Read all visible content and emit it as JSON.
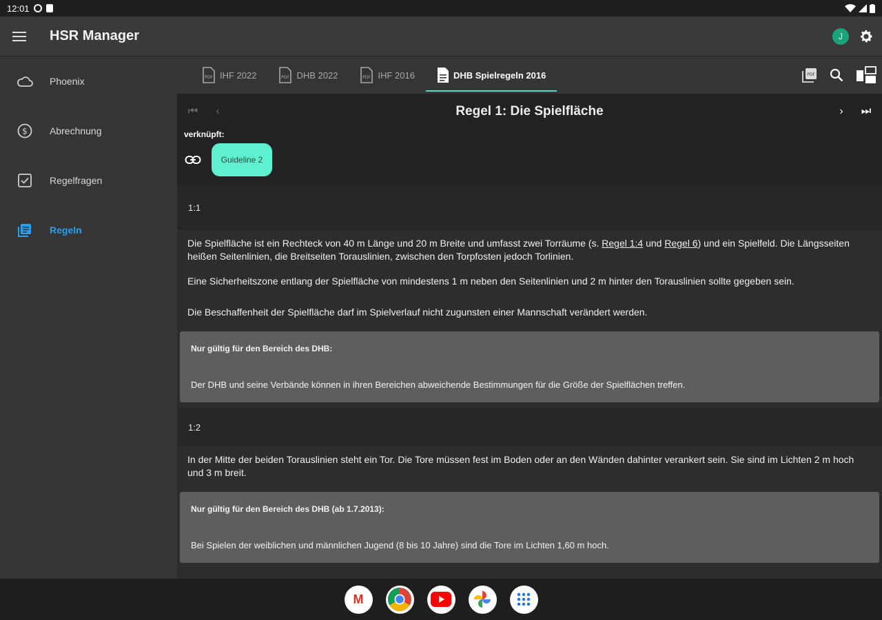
{
  "status": {
    "time": "12:01"
  },
  "app": {
    "title": "HSR Manager",
    "avatar_letter": "J"
  },
  "sidebar": {
    "items": [
      {
        "label": "Phoenix",
        "icon": "cloud-icon"
      },
      {
        "label": "Abrechnung",
        "icon": "dollar-icon"
      },
      {
        "label": "Regelfragen",
        "icon": "checkbox-icon"
      },
      {
        "label": "Regeln",
        "icon": "book-icon",
        "active": true
      }
    ]
  },
  "tabs": [
    {
      "label": "IHF 2022"
    },
    {
      "label": "DHB 2022"
    },
    {
      "label": "IHF 2016"
    },
    {
      "label": "DHB Spielregeln 2016",
      "active": true
    }
  ],
  "pager": {
    "title": "Regel 1: Die Spielfläche"
  },
  "linked": {
    "label": "verknüpft:",
    "chip": "Guideline 2"
  },
  "sections": [
    {
      "head": "1:1",
      "p1_a": "Die Spielfläche ist ein Rechteck von 40 m Länge und 20 m Breite und umfasst zwei Torräume (s. ",
      "p1_link1": "Regel 1:4",
      "p1_b": " und ",
      "p1_link2": "Regel 6",
      "p1_c": ")  und ein Spielfeld. Die Längsseiten heißen Seitenlinien, die Breitseiten  Torauslinien, zwischen den Torpfosten jedoch Torlinien.",
      "p2": "Eine Sicherheitszone entlang der Spielfläche von mindestens 1 m  neben den Seitenlinien und 2 m hinter den Torauslinien sollte gegeben sein.",
      "p3": "Die Beschaffenheit der Spielfläche darf im Spielverlauf nicht zugunsten einer Mannschaft verändert werden.",
      "note_title": "Nur gültig für den Bereich des DHB:",
      "note_text": "Der DHB und seine Verbände können in ihren Bereichen abweichende Bestimmungen für die Größe der Spielflächen treffen."
    },
    {
      "head": "1:2",
      "p1": "In der Mitte der beiden Torauslinien  steht ein Tor. Die Tore müssen fest im Boden oder an den Wänden dahinter  verankert sein. Sie sind im Lichten 2 m hoch und 3 m breit.",
      "note_title": "Nur gültig für den Bereich des DHB (ab 1.7.2013):",
      "note_text": "Bei Spielen der weiblichen und männlichen Jugend (8 bis 10 Jahre) sind die Tore im Lichten 1,60 m hoch."
    }
  ],
  "dock": [
    {
      "name": "gmail-app-icon",
      "glyph": "M",
      "color": "#d93025"
    },
    {
      "name": "chrome-app-icon",
      "glyph": "◉",
      "color": "#1a73e8"
    },
    {
      "name": "youtube-app-icon",
      "glyph": "▶",
      "color": "#ff0000"
    },
    {
      "name": "photos-app-icon",
      "glyph": "✿",
      "color": "#fbbc04"
    },
    {
      "name": "app-drawer-icon",
      "glyph": "⠿",
      "color": "#1a73e8"
    }
  ]
}
